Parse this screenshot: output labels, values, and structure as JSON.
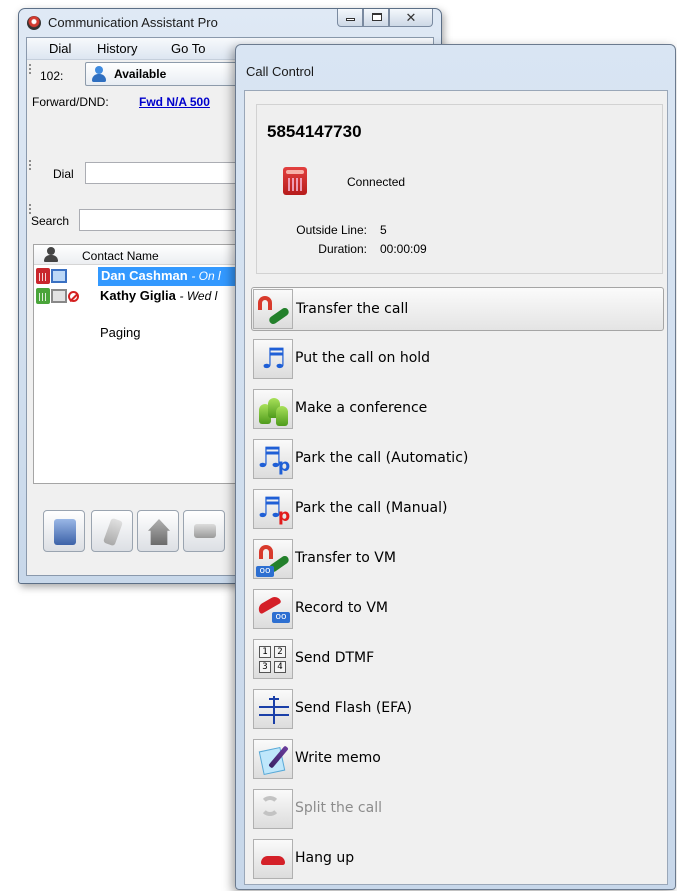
{
  "main_window": {
    "title": "Communication Assistant Pro",
    "menu": [
      "Dial",
      "History",
      "Go To"
    ],
    "extension_label": "102:",
    "presence_status": "Available",
    "forward_label": "Forward/DND:",
    "forward_value": "Fwd N/A 500",
    "dial_label": "Dial",
    "dial_value": "",
    "search_label": "Search",
    "search_value": "",
    "list_header": "Contact Name",
    "contacts": [
      {
        "name": "Dan Cashman",
        "status": "- On l"
      },
      {
        "name": "Kathy Giglia",
        "status": "- Wed l"
      }
    ],
    "paging_label": "Paging",
    "toolbar_icons": [
      "desk-phone-icon",
      "cell-phone-icon",
      "home-icon",
      "voicemail-icon"
    ]
  },
  "call_control": {
    "title": "Call Control",
    "phone_number": "5854147730",
    "call_state": "Connected",
    "outside_line_label": "Outside Line:",
    "outside_line_value": "5",
    "duration_label": "Duration:",
    "duration_value": "00:00:09",
    "actions": [
      {
        "label": "Transfer the call",
        "icon": "transfer-icon",
        "state": "highlighted"
      },
      {
        "label": "Put the call on hold",
        "icon": "music-note-icon",
        "state": "normal"
      },
      {
        "label": "Make a conference",
        "icon": "conference-icon",
        "state": "normal"
      },
      {
        "label": "Park the call (Automatic)",
        "icon": "park-automatic-icon",
        "state": "normal"
      },
      {
        "label": "Park the call (Manual)",
        "icon": "park-manual-icon",
        "state": "normal"
      },
      {
        "label": "Transfer to VM",
        "icon": "transfer-vm-icon",
        "state": "normal"
      },
      {
        "label": "Record to VM",
        "icon": "record-vm-icon",
        "state": "normal"
      },
      {
        "label": "Send DTMF",
        "icon": "dtmf-keypad-icon",
        "state": "normal"
      },
      {
        "label": "Send Flash (EFA)",
        "icon": "flash-icon",
        "state": "normal"
      },
      {
        "label": "Write memo",
        "icon": "memo-icon",
        "state": "normal"
      },
      {
        "label": "Split the call",
        "icon": "split-icon",
        "state": "disabled"
      },
      {
        "label": "Hang up",
        "icon": "hang-up-icon",
        "state": "normal"
      }
    ]
  },
  "colors": {
    "selection": "#3399ff",
    "link": "#0000cc",
    "disabled_text": "#8c8c8c"
  }
}
